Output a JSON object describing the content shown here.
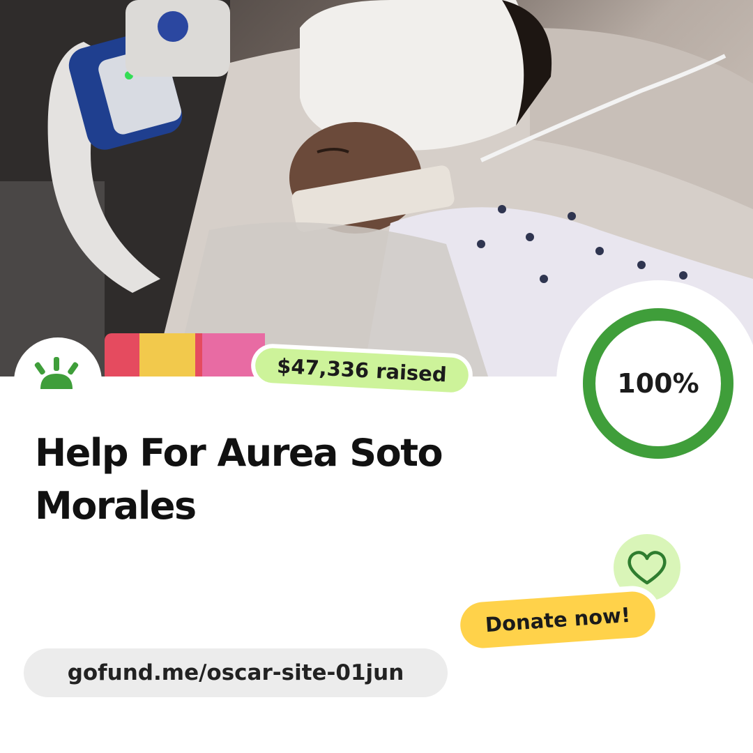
{
  "campaign": {
    "title": "Help For Aurea Soto Morales",
    "raised_label": "$47,336 raised",
    "progress_label": "100%",
    "progress_fraction": 1.0,
    "donate_label": "Donate now!",
    "url": "gofund.me/oscar-site-01jun"
  },
  "icons": {
    "logo": "sunrise-logo-icon",
    "heart": "heart-icon"
  },
  "colors": {
    "brand_green": "#3f9e3a",
    "raised_pill": "#cdf39a",
    "donate_pill": "#ffd24a",
    "heart_badge": "#d9f5b8",
    "url_pill": "#ececec"
  }
}
